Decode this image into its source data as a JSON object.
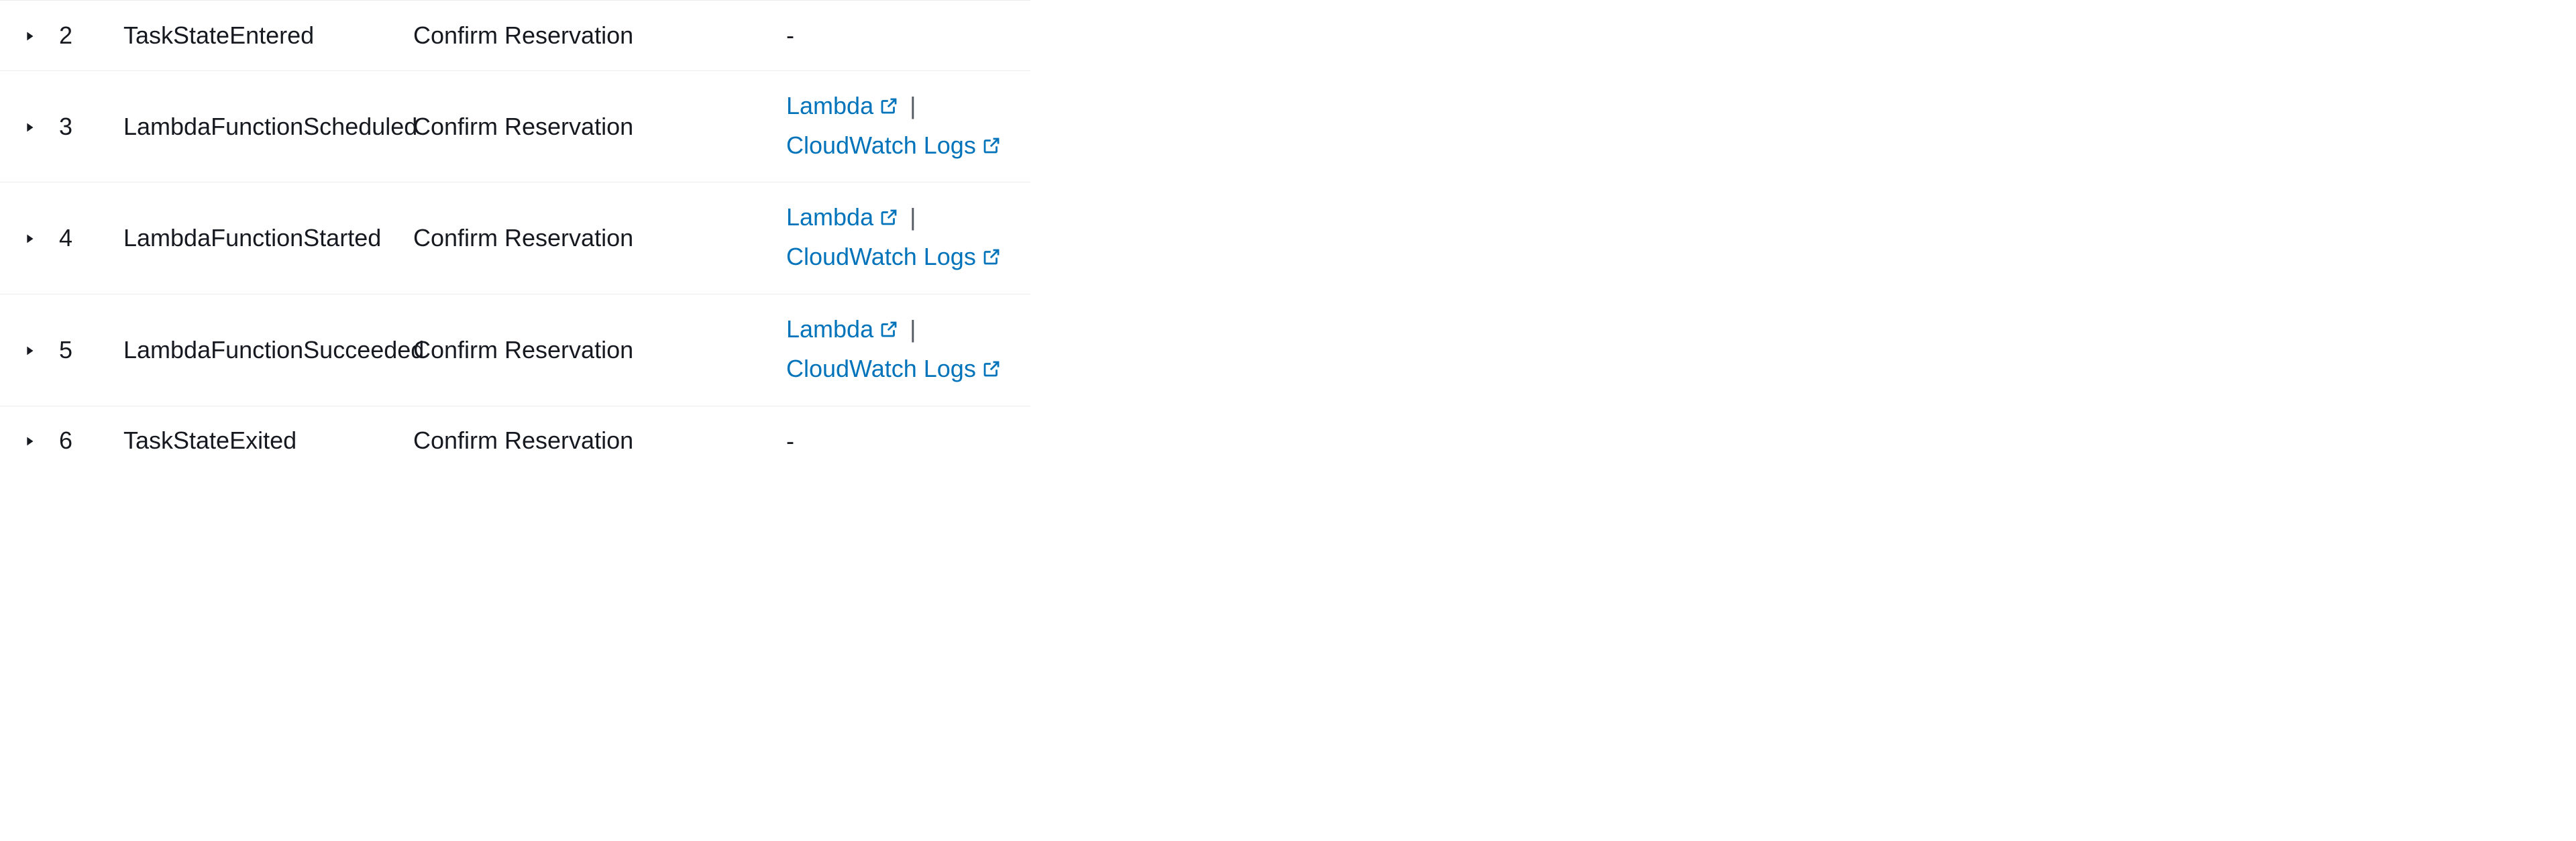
{
  "link_labels": {
    "lambda": "Lambda",
    "cwlogs": "CloudWatch Logs"
  },
  "separator": "|",
  "dash": "-",
  "events": [
    {
      "id": "2",
      "type": "TaskStateEntered",
      "step": "Confirm Reservation",
      "has_links": false
    },
    {
      "id": "3",
      "type": "LambdaFunctionScheduled",
      "step": "Confirm Reservation",
      "has_links": true
    },
    {
      "id": "4",
      "type": "LambdaFunctionStarted",
      "step": "Confirm Reservation",
      "has_links": true
    },
    {
      "id": "5",
      "type": "LambdaFunctionSucceeded",
      "step": "Confirm Reservation",
      "has_links": true
    },
    {
      "id": "6",
      "type": "TaskStateExited",
      "step": "Confirm Reservation",
      "has_links": false
    }
  ]
}
